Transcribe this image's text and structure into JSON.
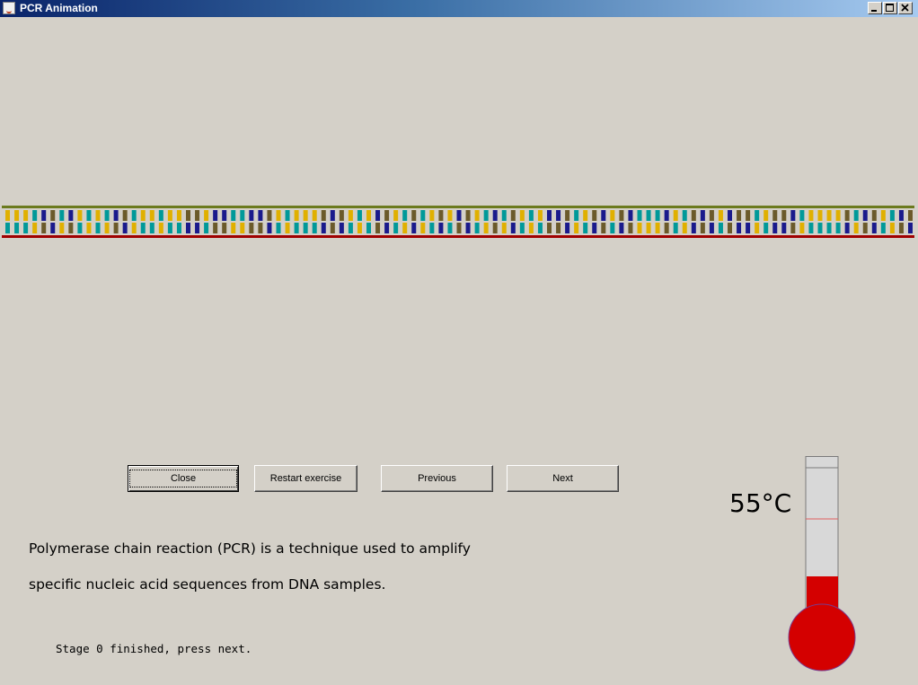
{
  "window": {
    "title": "PCR Animation",
    "icon": "java-coffee-icon",
    "controls": [
      "minimize-icon",
      "maximize-icon",
      "close-icon"
    ]
  },
  "dna": {
    "top_strand_color": "#6b7a1e",
    "bottom_strand_color": "#a00000",
    "base_colors": {
      "A": "#e0b000",
      "T": "#009999",
      "G": "#6b5a2a",
      "C": "#1a1a8c"
    },
    "base_pair_count": 101
  },
  "buttons": {
    "close": "Close",
    "restart": "Restart exercise",
    "previous": "Previous",
    "next": "Next"
  },
  "description": {
    "line1": "Polymerase chain reaction (PCR) is a technique used to amplify",
    "line2": "specific nucleic acid sequences from DNA samples."
  },
  "status": "Stage 0 finished, press next.",
  "thermometer": {
    "label": "55°C",
    "value_celsius": 55,
    "mercury_color": "#d40000",
    "tube_color": "#d8d8d8",
    "marker_color": "#e06060"
  }
}
